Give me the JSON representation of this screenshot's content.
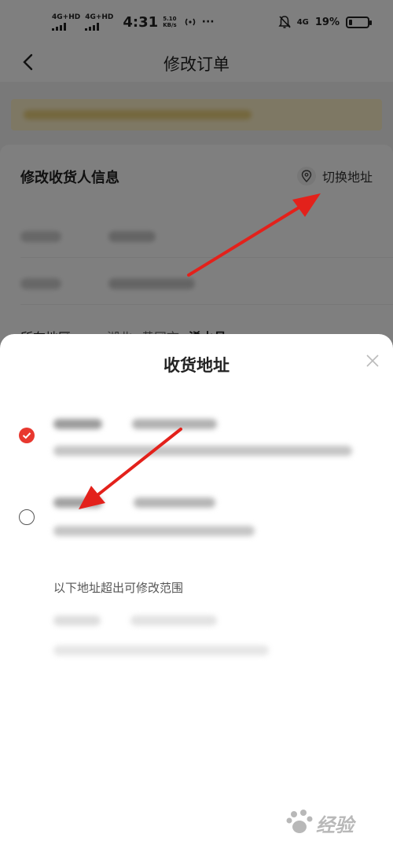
{
  "status_bar": {
    "network_1": "4G+HD",
    "network_2": "4G+HD",
    "time": "4:31",
    "net_speed_value": "5.10",
    "net_speed_unit": "KB/s",
    "more": "···",
    "mobile_data": "4G",
    "battery_text": "19%",
    "battery_level": 0.19
  },
  "header": {
    "title": "修改订单"
  },
  "receiver_card": {
    "title": "修改收货人信息",
    "switch_address_label": "切换地址",
    "region_label": "所在地区",
    "region_value_1": "湖北",
    "region_value_2": "黄冈市",
    "region_value_3": "浠水县"
  },
  "address_sheet": {
    "title": "收货地址",
    "out_of_range_label": "以下地址超出可修改范围"
  },
  "colors": {
    "accent": "#e8382f",
    "annotation_arrow": "#e3211b"
  },
  "icons": {
    "back": "chevron-left-icon",
    "location": "location-pin-icon",
    "close": "close-icon",
    "checked": "check-circle-icon"
  },
  "watermark": {
    "text": "经验"
  }
}
